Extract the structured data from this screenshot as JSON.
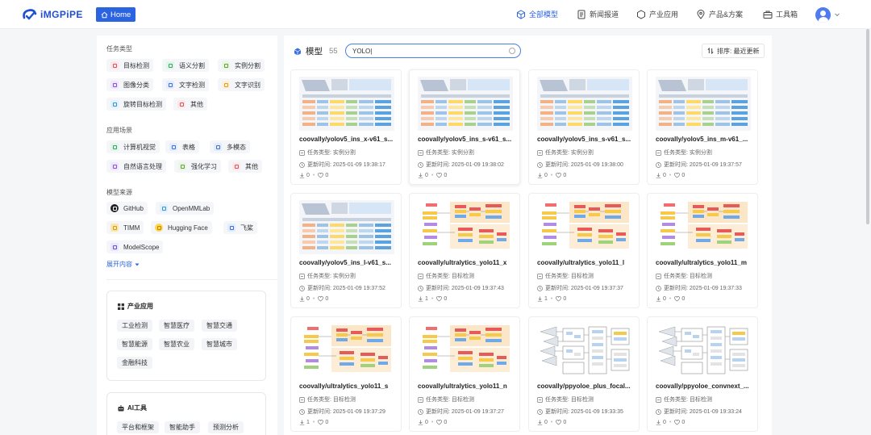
{
  "header": {
    "logo_text": "iMGPiPE",
    "home_label": "Home",
    "nav": [
      {
        "label": "全部模型",
        "icon": "cube-icon",
        "active": true
      },
      {
        "label": "新闻报道",
        "icon": "document-icon"
      },
      {
        "label": "产业应用",
        "icon": "hexagon-icon"
      },
      {
        "label": "产品&方案",
        "icon": "location-icon"
      },
      {
        "label": "工具箱",
        "icon": "toolbox-icon"
      }
    ],
    "accent": "#2b64e0"
  },
  "sidebar": {
    "task_title": "任务类型",
    "tasks": [
      "目标检测",
      "语义分割",
      "实例分割",
      "图像分类",
      "文字检测",
      "文字识别",
      "旋转目标检测",
      "其他"
    ],
    "scene_title": "应用场景",
    "scenes": [
      "计算机视觉",
      "表格",
      "多模态",
      "自然语言处理",
      "强化学习",
      "其他"
    ],
    "source_title": "模型来源",
    "sources": [
      "GitHub",
      "OpenMMLab",
      "TIMM",
      "Hugging Face",
      "飞桨",
      "ModelScope"
    ],
    "expand_label": "展开内容",
    "industry": {
      "title": "产业应用",
      "tags": [
        "工业检测",
        "智慧医疗",
        "智慧交通",
        "智慧能源",
        "智慧农业",
        "智慧城市",
        "金融科技"
      ]
    },
    "ai_tools": {
      "title": "AI工具",
      "tags": [
        "平台和框架",
        "智能助手",
        "预测分析"
      ]
    }
  },
  "main": {
    "title": "模型",
    "count": "55",
    "search_value": "YOLO|",
    "sort_label": "排序: 最近更新",
    "task_prefix": "任务类型: ",
    "time_prefix": "更新时间: ",
    "cards": [
      {
        "name": "coovally/yolov5_ins_x-v61_s...",
        "task": "实例分割",
        "time": "2025-01-09 19:38:17",
        "downloads": "0",
        "likes": "0",
        "thumb": "table"
      },
      {
        "name": "coovally/yolov5_ins_s-v61_s...",
        "task": "实例分割",
        "time": "2025-01-09 19:38:02",
        "downloads": "0",
        "likes": "0",
        "thumb": "table"
      },
      {
        "name": "coovally/yolov5_ins_s-v61_s...",
        "task": "实例分割",
        "time": "2025-01-09 19:38:00",
        "downloads": "0",
        "likes": "0",
        "thumb": "table"
      },
      {
        "name": "coovally/yolov5_ins_m-v61_...",
        "task": "实例分割",
        "time": "2025-01-09 19:37:57",
        "downloads": "0",
        "likes": "0",
        "thumb": "table"
      },
      {
        "name": "coovally/yolov5_ins_l-v61_s...",
        "task": "实例分割",
        "time": "2025-01-09 19:37:52",
        "downloads": "0",
        "likes": "0",
        "thumb": "table"
      },
      {
        "name": "coovally/ultralytics_yolo11_x",
        "task": "目标检测",
        "time": "2025-01-09 19:37:43",
        "downloads": "1",
        "likes": "0",
        "thumb": "flow"
      },
      {
        "name": "coovally/ultralytics_yolo11_l",
        "task": "目标检测",
        "time": "2025-01-09 19:37:37",
        "downloads": "1",
        "likes": "0",
        "thumb": "flow"
      },
      {
        "name": "coovally/ultralytics_yolo11_m",
        "task": "目标检测",
        "time": "2025-01-09 19:37:33",
        "downloads": "0",
        "likes": "0",
        "thumb": "flow"
      },
      {
        "name": "coovally/ultralytics_yolo11_s",
        "task": "目标检测",
        "time": "2025-01-09 19:37:29",
        "downloads": "1",
        "likes": "0",
        "thumb": "flow"
      },
      {
        "name": "coovally/ultralytics_yolo11_n",
        "task": "目标检测",
        "time": "2025-01-09 19:37:27",
        "downloads": "0",
        "likes": "0",
        "thumb": "flow"
      },
      {
        "name": "coovally/ppyoloe_plus_focal...",
        "task": "目标检测",
        "time": "2025-01-09 19:33:35",
        "downloads": "0",
        "likes": "0",
        "thumb": "arch"
      },
      {
        "name": "coovally/ppyoloe_convnext_...",
        "task": "目标检测",
        "time": "2025-01-09 19:33:24",
        "downloads": "0",
        "likes": "0",
        "thumb": "arch"
      }
    ]
  }
}
